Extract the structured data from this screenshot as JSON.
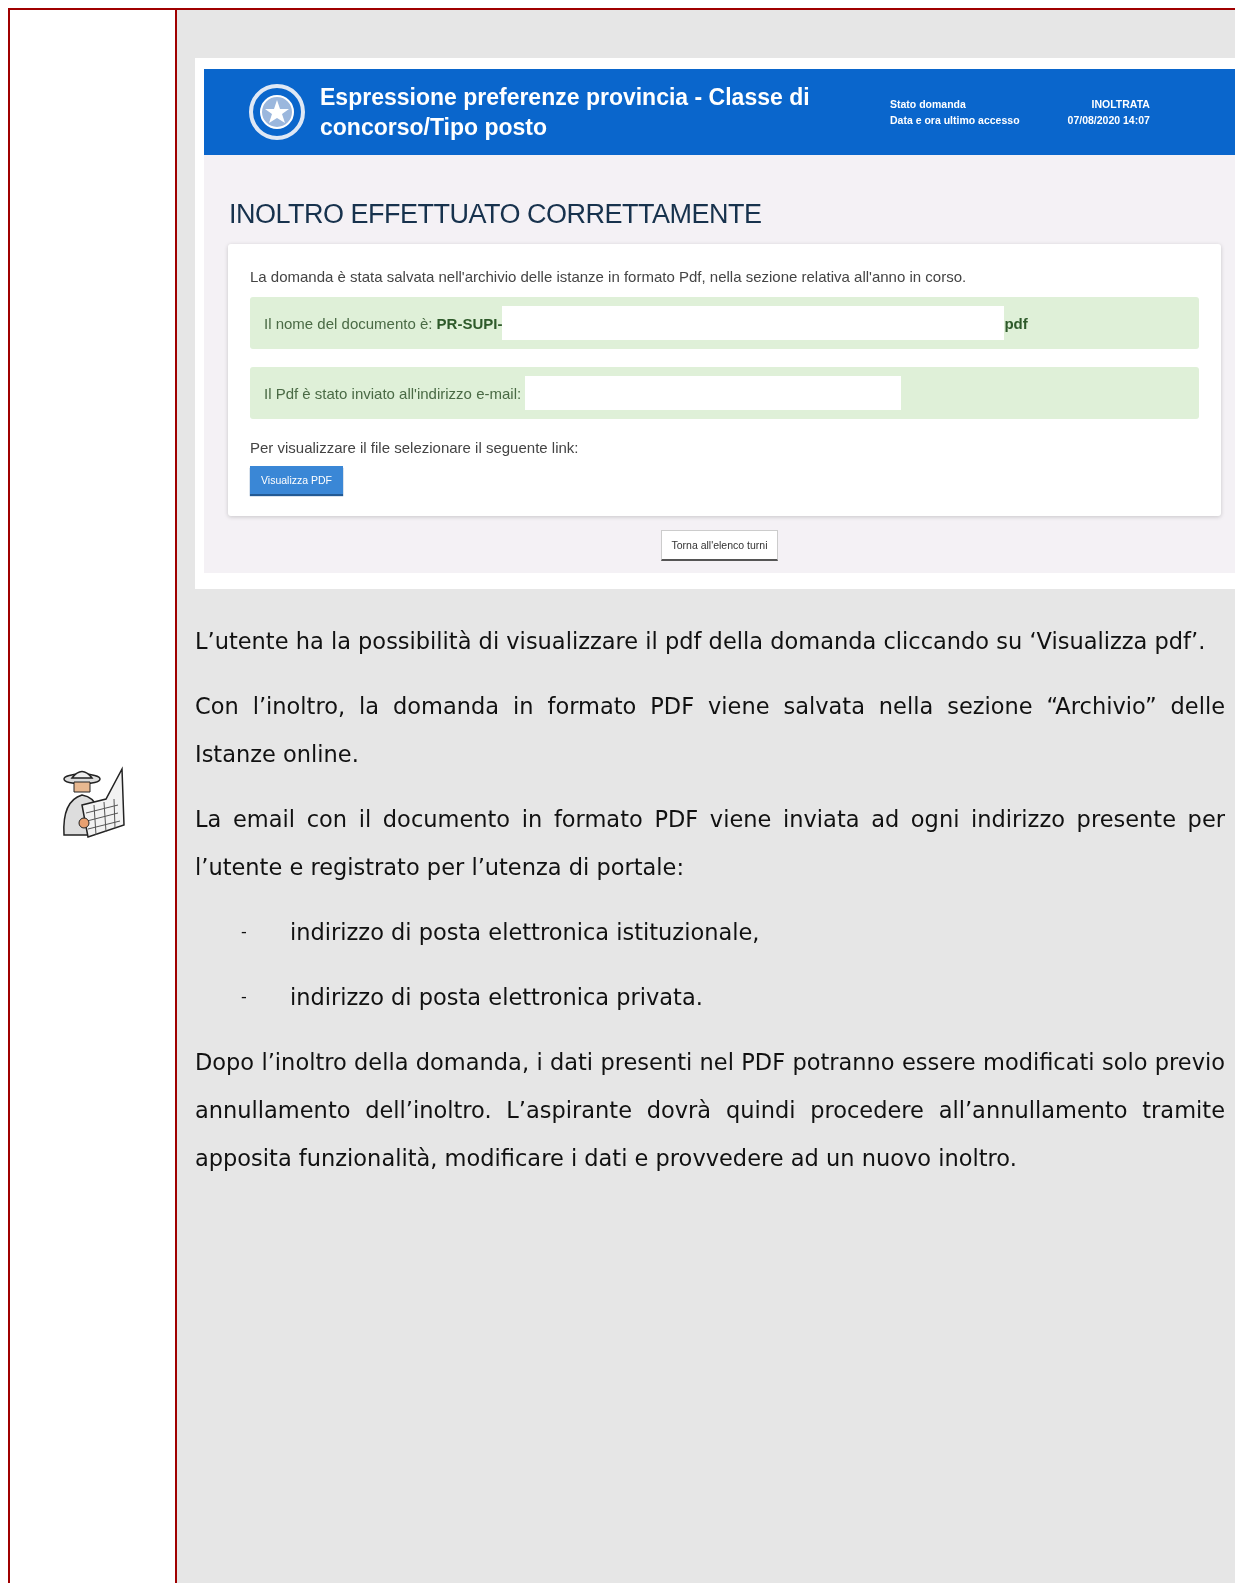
{
  "screenshot": {
    "header": {
      "title": "Espressione preferenze provincia - Classe di concorso/Tipo posto",
      "status_label": "Stato domanda",
      "status_value": "INOLTRATA",
      "date_label": "Data e ora ultimo accesso",
      "date_value": "07/08/2020 14:07"
    },
    "heading": "INOLTRO EFFETTUATO CORRETTAMENTE",
    "intro": "La domanda è stata salvata nell'archivio delle istanze in formato Pdf, nella sezione relativa all'anno in corso.",
    "document_name": {
      "label": "Il nome del documento è:",
      "prefix": "PR-SUPI-",
      "suffix": "pdf"
    },
    "email": {
      "label": "Il Pdf è stato inviato all'indirizzo e-mail:"
    },
    "link_prompt": "Per visualizzare il file selezionare il seguente link:",
    "view_button": "Visualizza PDF",
    "back_button": "Torna all'elenco turni"
  },
  "body": [
    {
      "kind": "paragraph",
      "text": "L’utente ha la possibilità di visualizzare il pdf della domanda cliccando su ‘Visualizza pdf’."
    },
    {
      "kind": "paragraph",
      "text": "Con l’inoltro, la domanda in formato PDF viene salvata nella sezione “Archivio” delle Istanze online."
    },
    {
      "kind": "paragraph",
      "text": "La email con il documento in formato PDF viene inviata ad ogni indirizzo presente per l’utente e registrato per l’utenza di portale:"
    },
    {
      "kind": "bullet",
      "marker": "-",
      "text": "indirizzo di posta elettronica istituzionale,"
    },
    {
      "kind": "bullet",
      "marker": "-",
      "text": "indirizzo di posta elettronica privata."
    },
    {
      "kind": "paragraph",
      "text": "Dopo l’inoltro della domanda, i dati presenti nel PDF potranno essere modificati solo previo annullamento dell’inoltro. L’aspirante dovrà quindi procedere all’annullamento tramite apposita funzionalità, modificare i dati e provvedere ad un nuovo inoltro."
    }
  ]
}
